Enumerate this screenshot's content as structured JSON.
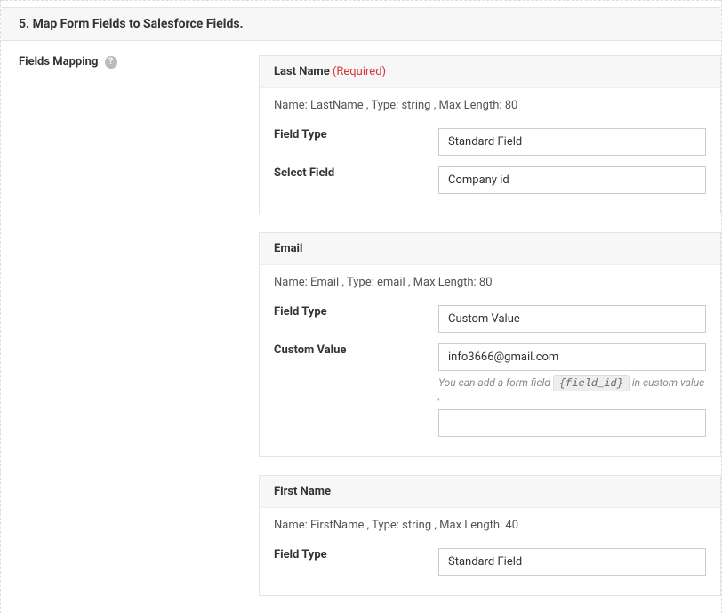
{
  "step": {
    "number": "5.",
    "title": "Map Form Fields to Salesforce Fields."
  },
  "sidebar": {
    "label": "Fields Mapping"
  },
  "helpIcon": "?",
  "labels": {
    "fieldType": "Field Type",
    "selectField": "Select Field",
    "customValue": "Custom Value",
    "required": " (Required)"
  },
  "hint": {
    "prefix": "You can add a form field ",
    "code": "{field_id}",
    "suffix": " in custom value ,"
  },
  "blocks": [
    {
      "title": "Last Name",
      "required": true,
      "meta": "Name: LastName , Type: string , Max Length: 80",
      "fieldType": "Standard Field",
      "selectField": "Company id"
    },
    {
      "title": "Email",
      "required": false,
      "meta": "Name: Email , Type: email , Max Length: 80",
      "fieldType": "Custom Value",
      "customValue": "info3666@gmail.com",
      "extraInput": ""
    },
    {
      "title": "First Name",
      "required": false,
      "meta": "Name: FirstName , Type: string , Max Length: 40",
      "fieldType": "Standard Field"
    }
  ]
}
